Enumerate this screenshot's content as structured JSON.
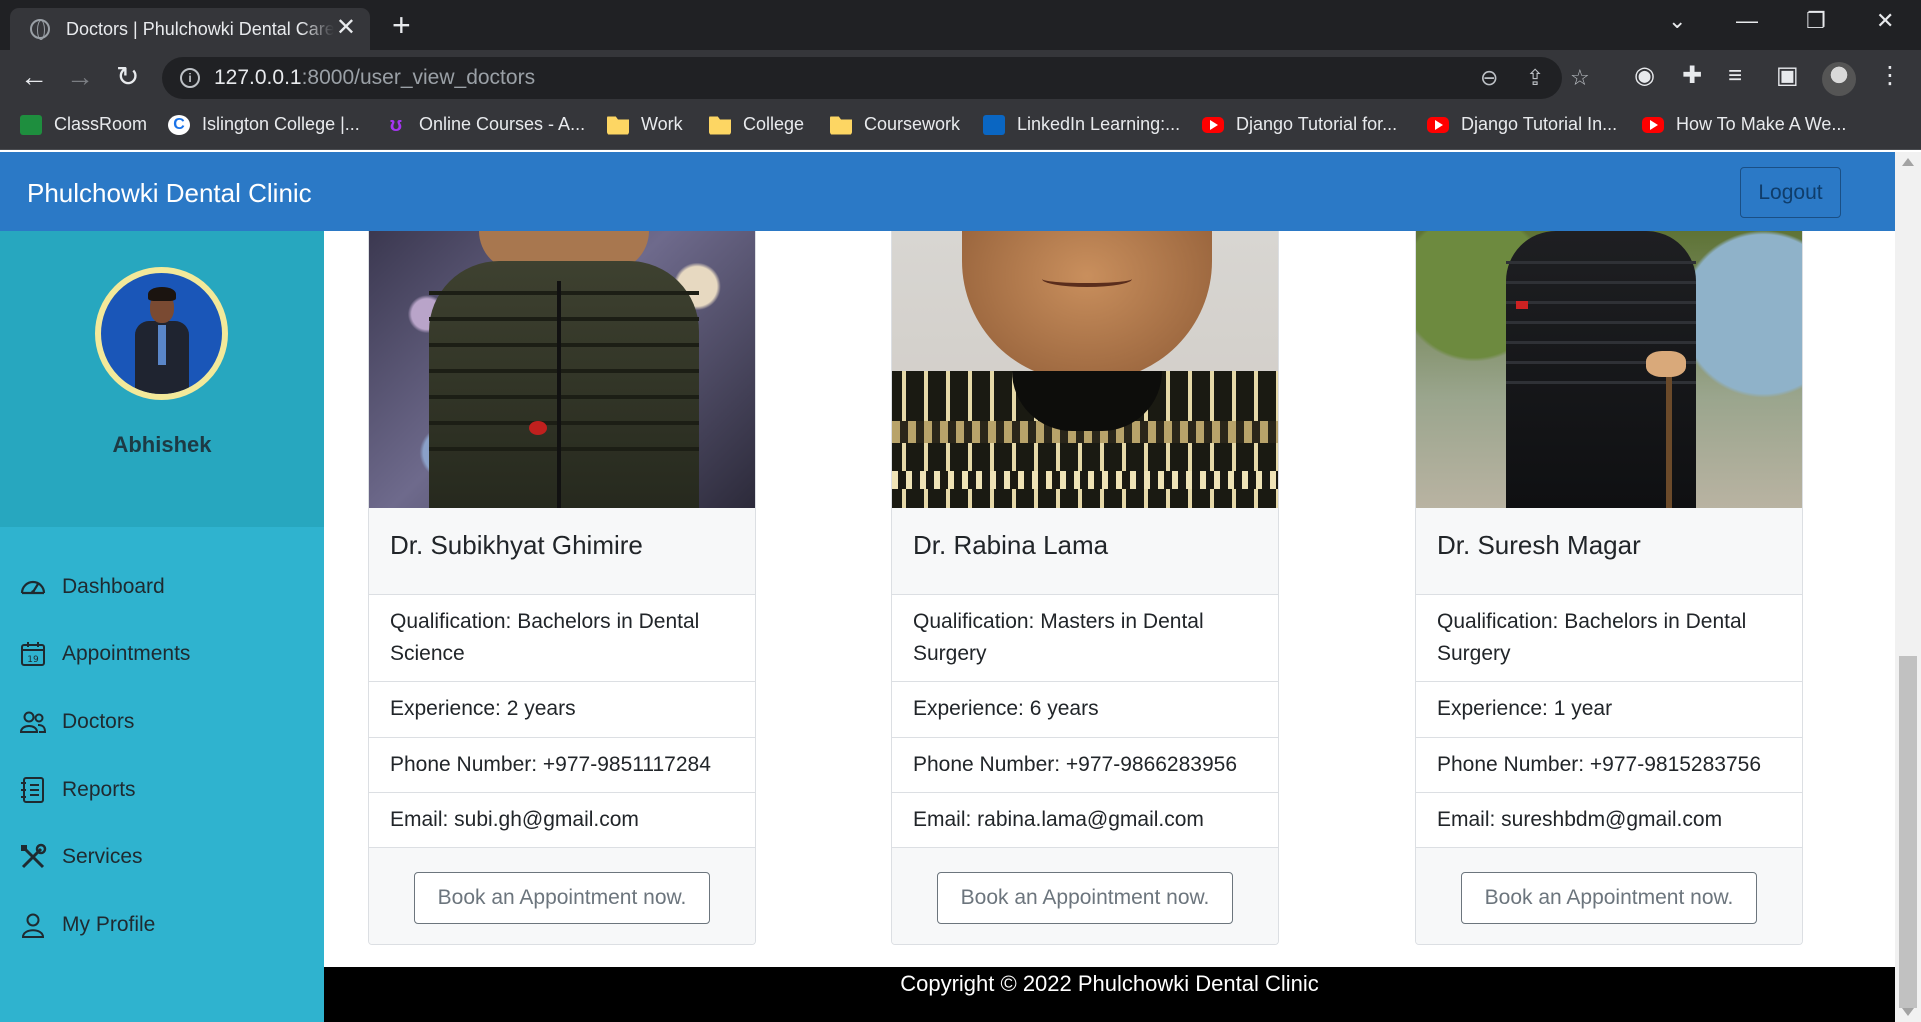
{
  "browser": {
    "tab_title": "Doctors | Phulchowki Dental Care",
    "tab_close": "✕",
    "new_tab": "+",
    "url_host": "127.0.0.1",
    "url_path": ":8000/user_view_doctors",
    "window_controls": {
      "minimize": "—",
      "restore": "❐",
      "close": "✕",
      "tab_search": "⌄"
    },
    "nav": {
      "back": "←",
      "forward": "→",
      "reload": "↻"
    },
    "bookmarks": [
      {
        "label": "ClassRoom",
        "icon": "google-classroom-icon"
      },
      {
        "label": "Islington College |...",
        "icon": "islington-college-icon"
      },
      {
        "label": "Online Courses - A...",
        "icon": "udemy-icon"
      },
      {
        "label": "Work",
        "icon": "folder-icon"
      },
      {
        "label": "College",
        "icon": "folder-icon"
      },
      {
        "label": "Coursework",
        "icon": "folder-icon"
      },
      {
        "label": "LinkedIn Learning:...",
        "icon": "linkedin-learning-icon"
      },
      {
        "label": "Django Tutorial for...",
        "icon": "youtube-icon"
      },
      {
        "label": "Django Tutorial In...",
        "icon": "youtube-icon"
      },
      {
        "label": "How To Make A We...",
        "icon": "youtube-icon"
      }
    ]
  },
  "navbar": {
    "brand": "Phulchowki Dental Clinic",
    "logout_label": "Logout",
    "color": "#2b79c6"
  },
  "sidebar": {
    "user_name": "Abhishek",
    "items": [
      {
        "label": "Dashboard",
        "icon": "speedometer-icon"
      },
      {
        "label": "Appointments",
        "icon": "calendar-icon"
      },
      {
        "label": "Doctors",
        "icon": "people-icon"
      },
      {
        "label": "Reports",
        "icon": "report-list-icon"
      },
      {
        "label": "Services",
        "icon": "tools-icon"
      },
      {
        "label": "My Profile",
        "icon": "person-icon"
      }
    ],
    "color": "#2fb3cf"
  },
  "doctors": [
    {
      "name": "Dr. Subikhyat Ghimire",
      "qualification": "Qualification: Bachelors in Dental Science",
      "experience": "Experience: 2 years",
      "phone": "Phone Number: +977-9851117284",
      "email": "Email: subi.gh@gmail.com",
      "book_label": "Book an Appointment now."
    },
    {
      "name": "Dr. Rabina Lama",
      "qualification": "Qualification: Masters in Dental Surgery",
      "experience": "Experience: 6 years",
      "phone": "Phone Number: +977-9866283956",
      "email": "Email: rabina.lama@gmail.com",
      "book_label": "Book an Appointment now."
    },
    {
      "name": "Dr. Suresh Magar",
      "qualification": "Qualification: Bachelors in Dental Surgery",
      "experience": "Experience: 1 year",
      "phone": "Phone Number: +977-9815283756",
      "email": "Email: sureshbdm@gmail.com",
      "book_label": "Book an Appointment now."
    }
  ],
  "footer": {
    "text": "Copyright © 2022 Phulchowki Dental Clinic"
  }
}
